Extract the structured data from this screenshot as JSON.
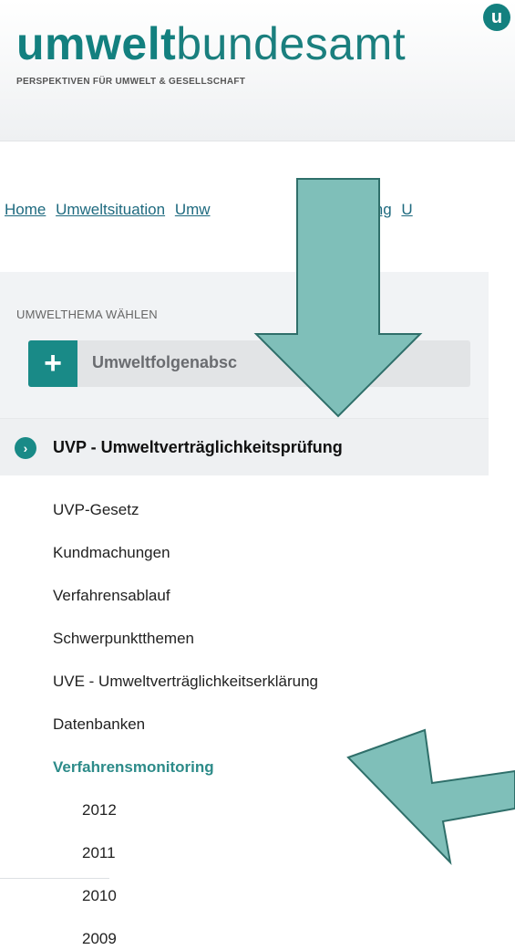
{
  "header": {
    "logo_bold": "umwelt",
    "logo_light": "bundesamt",
    "logo_badge": "u",
    "tagline": "PERSPEKTIVEN FÜR UMWELT & GESELLSCHAFT"
  },
  "breadcrumb": {
    "items": [
      "Home",
      "Umweltsituation",
      "Umw",
      "abschätzung",
      "U"
    ]
  },
  "sidebar": {
    "panel_title": "UMWELTHEMA WÄHLEN",
    "select_label": "Umweltfolgenabsc",
    "plus_symbol": "+",
    "current_section": "UVP - Umweltverträglichkeitsprüfung",
    "current_icon": "chevron-right-icon"
  },
  "nav": {
    "items": [
      "UVP-Gesetz",
      "Kundmachungen",
      "Verfahrensablauf",
      "Schwerpunktthemen",
      "UVE - Umweltverträglichkeitserklärung",
      "Datenbanken",
      "Verfahrensmonitoring"
    ],
    "years": [
      "2012",
      "2011",
      "2010",
      "2009"
    ]
  },
  "colors": {
    "brand": "#13807f",
    "accent": "#198a87",
    "arrow": "#7fbfb9",
    "link": "#1e6a7f"
  }
}
